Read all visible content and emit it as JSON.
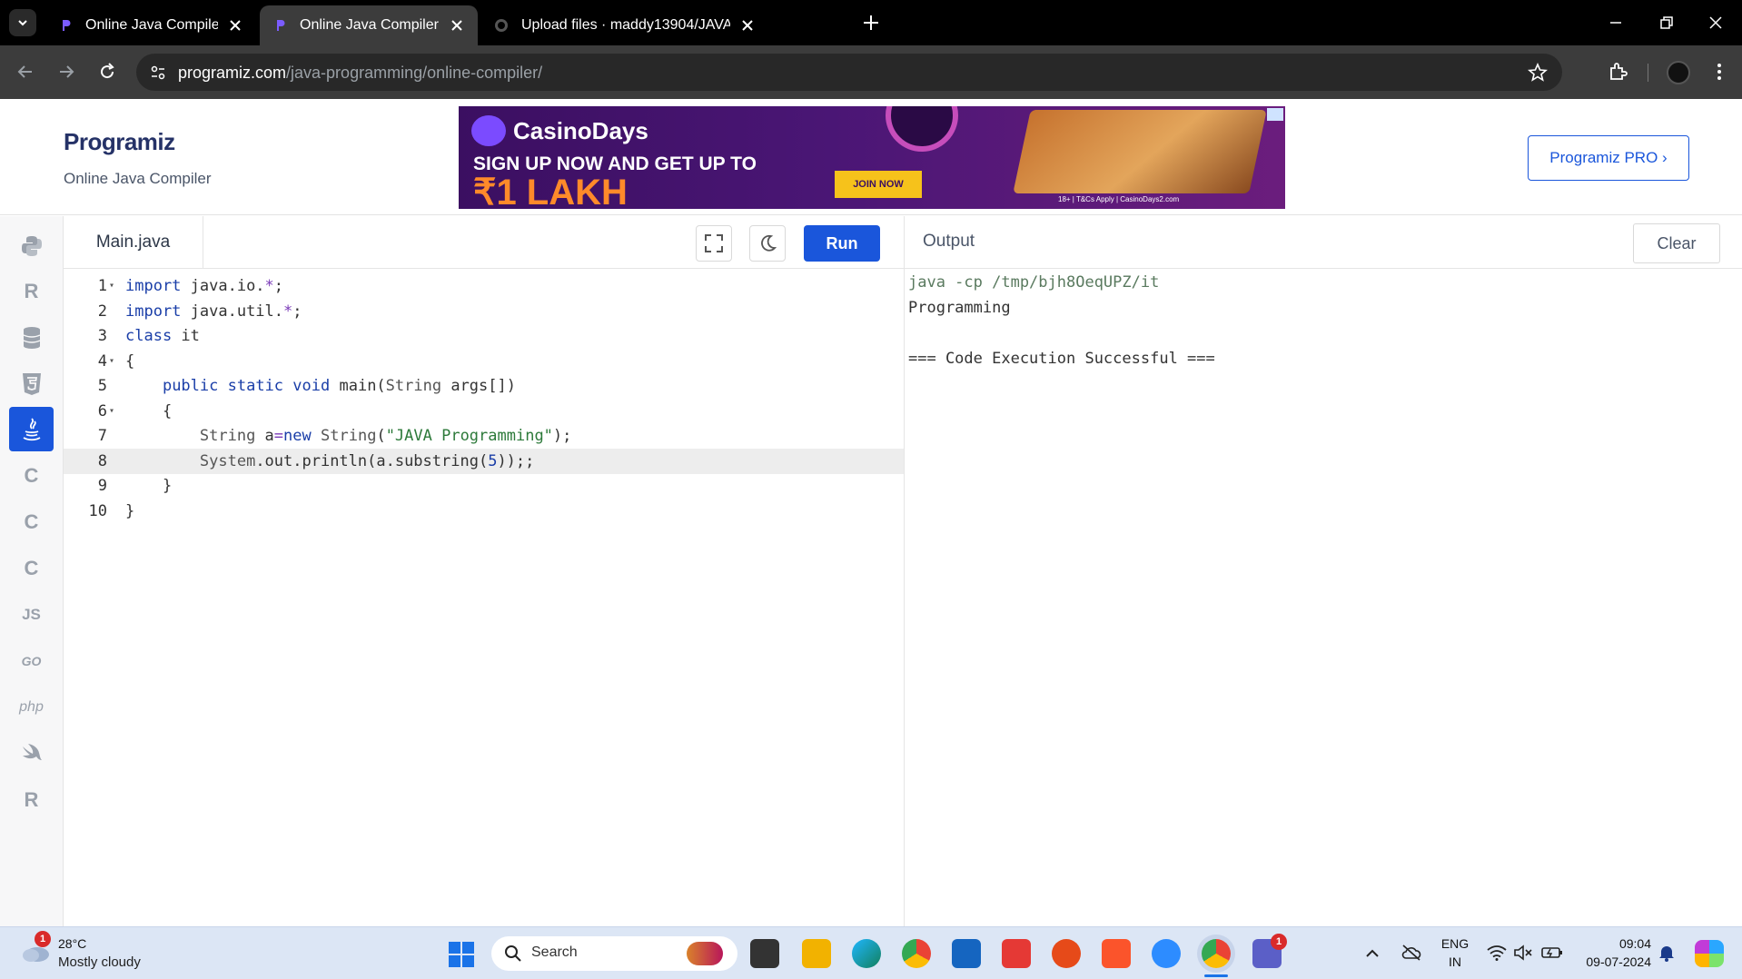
{
  "browser": {
    "tabs": [
      {
        "label": "Online Java Compiler",
        "active": false
      },
      {
        "label": "Online Java Compiler",
        "active": true
      },
      {
        "label": "Upload files · maddy13904/JAVA",
        "active": false
      }
    ],
    "url_host": "programiz.com",
    "url_path": "/java-programming/online-compiler/"
  },
  "header": {
    "logo": "Programiz",
    "subtitle": "Online Java Compiler",
    "pro_button": "Programiz PRO ›"
  },
  "ad": {
    "brand": "CasinoDays",
    "line1": "SIGN UP NOW AND GET UP TO",
    "line2": "₹1 LAKH",
    "cta": "JOIN NOW",
    "terms": "18+ | T&Cs Apply | CasinoDays2.com"
  },
  "languages": [
    {
      "name": "python-icon",
      "glyph": "",
      "active": false
    },
    {
      "name": "r-icon",
      "glyph": "R",
      "active": false
    },
    {
      "name": "sql-icon",
      "glyph": "",
      "active": false
    },
    {
      "name": "html-icon",
      "glyph": "5",
      "active": false
    },
    {
      "name": "java-icon",
      "glyph": "",
      "active": true
    },
    {
      "name": "c-icon",
      "glyph": "C",
      "active": false
    },
    {
      "name": "cpp-icon",
      "glyph": "C",
      "active": false
    },
    {
      "name": "csharp-icon",
      "glyph": "C",
      "active": false
    },
    {
      "name": "js-icon",
      "glyph": "JS",
      "active": false
    },
    {
      "name": "go-icon",
      "glyph": "GO",
      "active": false
    },
    {
      "name": "php-icon",
      "glyph": "php",
      "active": false
    },
    {
      "name": "swift-icon",
      "glyph": "",
      "active": false
    },
    {
      "name": "rust-icon",
      "glyph": "R",
      "active": false
    }
  ],
  "editor": {
    "file_name": "Main.java",
    "run_label": "Run",
    "lines": [
      {
        "n": "1",
        "fold": true,
        "html": "<span class=\"kw\">import</span> java.io.<span class=\"op\">*</span>;"
      },
      {
        "n": "2",
        "fold": false,
        "html": "<span class=\"kw\">import</span> java.util.<span class=\"op\">*</span>;"
      },
      {
        "n": "3",
        "fold": false,
        "html": "<span class=\"kw\">class</span> it"
      },
      {
        "n": "4",
        "fold": true,
        "html": "{"
      },
      {
        "n": "5",
        "fold": false,
        "html": "    <span class=\"kw\">public</span> <span class=\"kw\">static</span> <span class=\"kw\">void</span> main(<span class=\"typ\">String</span> args[])"
      },
      {
        "n": "6",
        "fold": true,
        "html": "    {"
      },
      {
        "n": "7",
        "fold": false,
        "html": "        <span class=\"typ\">String</span> a<span class=\"op\">=</span><span class=\"kw\">new</span> <span class=\"typ\">String</span>(<span class=\"str\">\"JAVA Programming\"</span>);"
      },
      {
        "n": "8",
        "fold": false,
        "html": "        <span class=\"typ\">System</span>.out.println(a.substring(<span class=\"num\">5</span>));;"
      },
      {
        "n": "9",
        "fold": false,
        "html": "    }"
      },
      {
        "n": "10",
        "fold": false,
        "html": "}"
      }
    ],
    "highlighted_line": "8"
  },
  "output": {
    "title": "Output",
    "clear_label": "Clear",
    "lines": [
      {
        "text": "java -cp /tmp/bjh8OeqUPZ/it",
        "cmd": true
      },
      {
        "text": "Programming",
        "cmd": false
      },
      {
        "text": "",
        "cmd": false
      },
      {
        "text": "=== Code Execution Successful ===",
        "cmd": false
      }
    ]
  },
  "taskbar": {
    "weather_temp": "28°C",
    "weather_desc": "Mostly cloudy",
    "weather_badge": "1",
    "search_label": "Search",
    "teams_badge": "1",
    "lang_top": "ENG",
    "lang_bottom": "IN",
    "time": "09:04",
    "date": "09-07-2024"
  }
}
